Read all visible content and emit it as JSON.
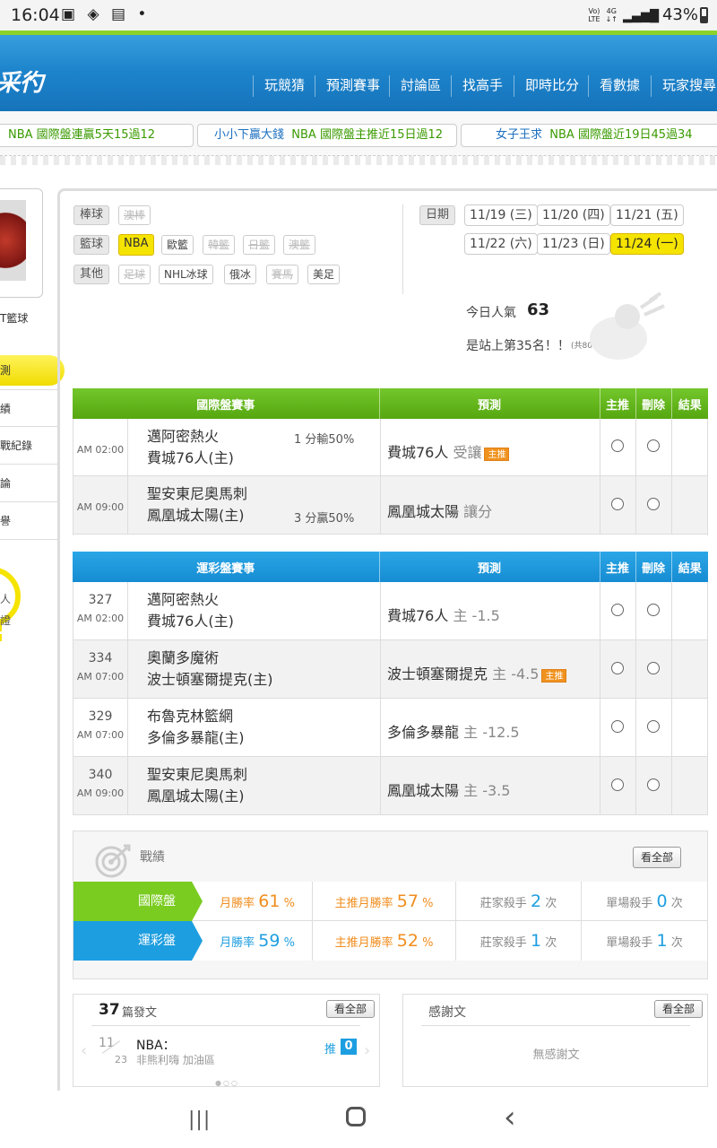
{
  "status": {
    "time": "16:04",
    "icons": "▣ ◈ ▤ •",
    "net_top": "Vo)",
    "net_bottom": "LTE",
    "net2_top": "4G",
    "net2_bottom": "↓↑",
    "signal": "▂▄▆█",
    "battery": "43%"
  },
  "nav": {
    "logo": "采彴",
    "items": [
      "玩競猜",
      "預測賽事",
      "討論區",
      "找高手",
      "即時比分",
      "看數據",
      "玩家搜尋"
    ]
  },
  "ticker": [
    {
      "user": "",
      "text": "NBA  國際盤連贏5天15過12"
    },
    {
      "user": "小小下贏大錢",
      "text": "NBA  國際盤主推近15日過12"
    },
    {
      "user": "女子王求",
      "text": "NBA  國際盤近19日45過34"
    }
  ],
  "left": {
    "name_partial": "T籃球",
    "highlight": "測",
    "menu": [
      "績",
      "戰紀錄",
      "論",
      "譽"
    ],
    "bulb_text": [
      "人",
      "證"
    ]
  },
  "filters": {
    "rows": [
      {
        "label": "棒球",
        "chips": [
          {
            "t": "澳棒",
            "state": "dis"
          }
        ]
      },
      {
        "label": "籃球",
        "chips": [
          {
            "t": "NBA",
            "state": "sel"
          },
          {
            "t": "歐籃",
            "state": ""
          },
          {
            "t": "韓籃",
            "state": "dis"
          },
          {
            "t": "日籃",
            "state": "dis"
          },
          {
            "t": "澳籃",
            "state": "dis"
          }
        ]
      },
      {
        "label": "其他",
        "chips": [
          {
            "t": "足球",
            "state": "dis"
          },
          {
            "t": "NHL冰球",
            "state": ""
          },
          {
            "t": "俄冰",
            "state": ""
          },
          {
            "t": "賽馬",
            "state": "dis"
          },
          {
            "t": "美足",
            "state": ""
          }
        ]
      }
    ],
    "date_label": "日期",
    "dates": [
      {
        "t": "11/19 (三)",
        "state": ""
      },
      {
        "t": "11/20 (四)",
        "state": ""
      },
      {
        "t": "11/21 (五)",
        "state": ""
      },
      {
        "t": "11/22 (六)",
        "state": ""
      },
      {
        "t": "11/23 (日)",
        "state": ""
      },
      {
        "t": "11/24 (一)",
        "state": "sel"
      }
    ]
  },
  "popularity": {
    "label": "今日人氣",
    "value": "63",
    "rank_text": "是站上第35名！！",
    "total": "(共8094人)"
  },
  "intl": {
    "headers": [
      "國際盤賽事",
      "預測",
      "主推",
      "刪除",
      "結果"
    ],
    "rows": [
      {
        "time": "AM 02:00",
        "team1": "邁阿密熱火",
        "team2": "費城76人(主)",
        "line1": "1 分輸50%",
        "line2": "",
        "pred": "費城76人",
        "pred_note": "受讓",
        "star": "主推"
      },
      {
        "time": "AM 09:00",
        "team1": "聖安東尼奧馬刺",
        "team2": "鳳凰城太陽(主)",
        "line1": "",
        "line2": "3 分贏50%",
        "pred": "鳳凰城太陽",
        "pred_note": "讓分",
        "star": ""
      }
    ]
  },
  "sports": {
    "headers": [
      "運彩盤賽事",
      "預測",
      "主推",
      "刪除",
      "結果"
    ],
    "rows": [
      {
        "num": "327",
        "time": "AM 02:00",
        "team1": "邁阿密熱火",
        "team2": "費城76人(主)",
        "pred": "費城76人",
        "pred_note": "主 -1.5",
        "star": ""
      },
      {
        "num": "334",
        "time": "AM 07:00",
        "team1": "奧蘭多魔術",
        "team2": "波士頓塞爾提克(主)",
        "pred": "波士頓塞爾提克",
        "pred_note": "主 -4.5",
        "star": "主推"
      },
      {
        "num": "329",
        "time": "AM 07:00",
        "team1": "布魯克林籃網",
        "team2": "多倫多暴龍(主)",
        "pred": "多倫多暴龍",
        "pred_note": "主 -12.5",
        "star": ""
      },
      {
        "num": "340",
        "time": "AM 09:00",
        "team1": "聖安東尼奧馬刺",
        "team2": "鳳凰城太陽(主)",
        "pred": "鳳凰城太陽",
        "pred_note": "主 -3.5",
        "star": ""
      }
    ]
  },
  "record": {
    "title": "戰績",
    "see_all": "看全部",
    "rows": [
      {
        "tag": "國際盤",
        "color": "#7acc20",
        "month_label": "月勝率",
        "month": "61",
        "main_label": "主推月勝率",
        "main": "57",
        "house_label": "莊家殺手",
        "house": "2",
        "single_label": "單場殺手",
        "single": "0",
        "unit": "次",
        "pct": "%"
      },
      {
        "tag": "運彩盤",
        "color": "#1d9ee0",
        "month_label": "月勝率",
        "month": "59",
        "main_label": "主推月勝率",
        "main": "52",
        "house_label": "莊家殺手",
        "house": "1",
        "single_label": "單場殺手",
        "single": "1",
        "unit": "次",
        "pct": "%"
      }
    ]
  },
  "posts": {
    "count": "37",
    "label": "篇發文",
    "see_all": "看全部",
    "day": "11",
    "month": "23",
    "title": "NBA：",
    "sub": "非熊利嗨 加油區",
    "push_label": "推",
    "push": "0"
  },
  "thanks": {
    "title": "感謝文",
    "see_all": "看全部",
    "empty": "無感謝文"
  },
  "softkeys": {
    "recent": "|||",
    "home": "◯",
    "back": "‹"
  }
}
